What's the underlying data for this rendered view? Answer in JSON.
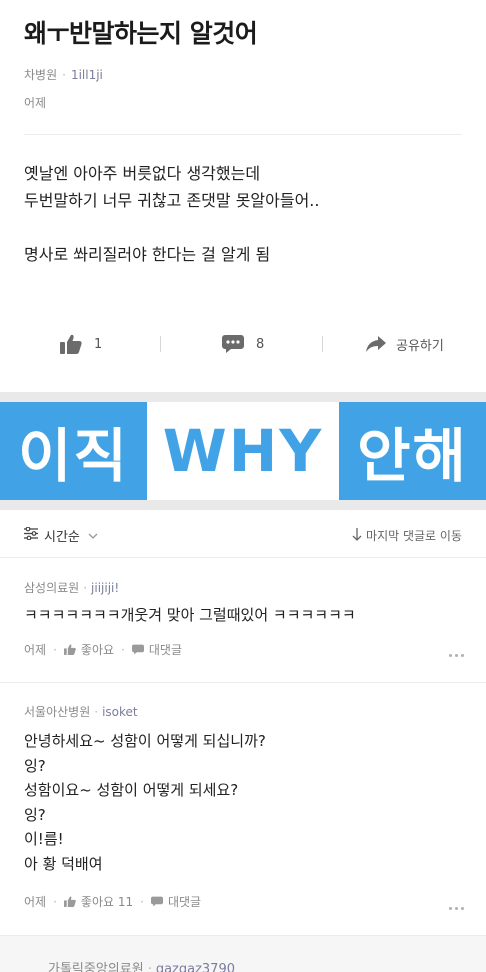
{
  "post": {
    "title": "왜ㅜ반말하는지 알것어",
    "hospital": "차병원",
    "meta_separator": "·",
    "author": "1ill1ji",
    "date": "어제",
    "body_lines": [
      "옛날엔 아아주 버릇없다 생각했는데",
      "두번말하기 너무 귀찮고 존댓말 못알아들어..",
      "",
      "명사로 쏴리질러야 한다는 걸 알게 됨"
    ],
    "actions": {
      "like_count": "1",
      "comment_count": "8",
      "share_label": "공유하기"
    }
  },
  "banner": {
    "left": "이직",
    "middle": "WHY",
    "right": "안해",
    "accent": "#41a3e6"
  },
  "sortbar": {
    "sort_label": "시간순",
    "jump_label": "마지막 댓글로 이동"
  },
  "comments": [
    {
      "hospital": "삼성의료원",
      "author": "jiijiji!",
      "lines": [
        "ㅋㅋㅋㅋㅋㅋㅋ개웃겨 맞아 그럴때있어 ㅋㅋㅋㅋㅋㅋ"
      ],
      "date": "어제",
      "like_label": "좋아요",
      "reply_label": "대댓글"
    },
    {
      "hospital": "서울아산병원",
      "author": "isoket",
      "lines": [
        "안녕하세요~ 성함이 어떻게 되십니까?",
        "잉?",
        "성함이요~ 성함이 어떻게 되세요?",
        "잉?",
        "이!름!",
        "아 황 덕배여"
      ],
      "date": "어제",
      "like_label": "좋아요 11",
      "reply_label": "대댓글"
    },
    {
      "hospital": "가톨릭중앙의료원",
      "author": "gazgaz3790"
    }
  ],
  "icons": {
    "like": "thumbs-up-icon",
    "comment": "speech-bubble-icon",
    "share": "share-arrow-icon",
    "sort": "sliders-icon",
    "chevron": "chevron-down-icon",
    "jump": "arrow-down-icon",
    "more": "more-dots-icon"
  }
}
